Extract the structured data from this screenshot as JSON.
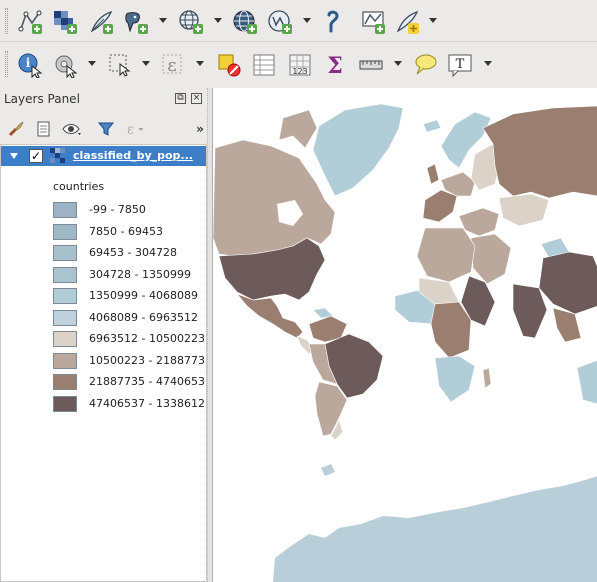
{
  "toolbar_top": {
    "icons": [
      "add-vector-layer-icon",
      "add-raster-layer-icon",
      "add-spatialite-layer-icon",
      "add-postgis-layer-icon",
      "add-wms-layer-icon",
      "add-wcs-layer-icon",
      "add-wfs-layer-icon",
      "add-delimited-text-icon",
      "add-virtual-layer-icon",
      "new-shapefile-icon"
    ]
  },
  "toolbar_bottom": {
    "icons": [
      "identify-icon",
      "select-icon",
      "select-rectangle-icon",
      "select-expression-icon",
      "deselect-icon",
      "attribute-table-icon",
      "field-calculator-icon",
      "statistics-icon",
      "measure-icon",
      "annotation-icon",
      "text-annotation-icon"
    ]
  },
  "layers_panel": {
    "title": "Layers Panel",
    "layer": {
      "name": "classified_by_pop...",
      "checked": true,
      "group_label": "countries",
      "legend": [
        {
          "label": "-99 - 7850",
          "color": "#9bb3c4"
        },
        {
          "label": "7850 - 69453",
          "color": "#9fb8c8"
        },
        {
          "label": "69453 - 304728",
          "color": "#a6c0cd"
        },
        {
          "label": "304728 - 1350999",
          "color": "#a9c4d0"
        },
        {
          "label": "1350999 - 4068089",
          "color": "#b1cdd8"
        },
        {
          "label": "4068089 - 6963512",
          "color": "#bdd2dc"
        },
        {
          "label": "6963512 - 10500223",
          "color": "#dcd3c8"
        },
        {
          "label": "10500223 - 2188773",
          "color": "#bba89c"
        },
        {
          "label": "21887735 - 4740653",
          "color": "#9a7f70"
        },
        {
          "label": "47406537 - 1338612",
          "color": "#6c5b5a"
        }
      ]
    }
  },
  "map": {
    "ocean_color": "#ffffff",
    "antarctica_color": "#b8cfd9"
  }
}
